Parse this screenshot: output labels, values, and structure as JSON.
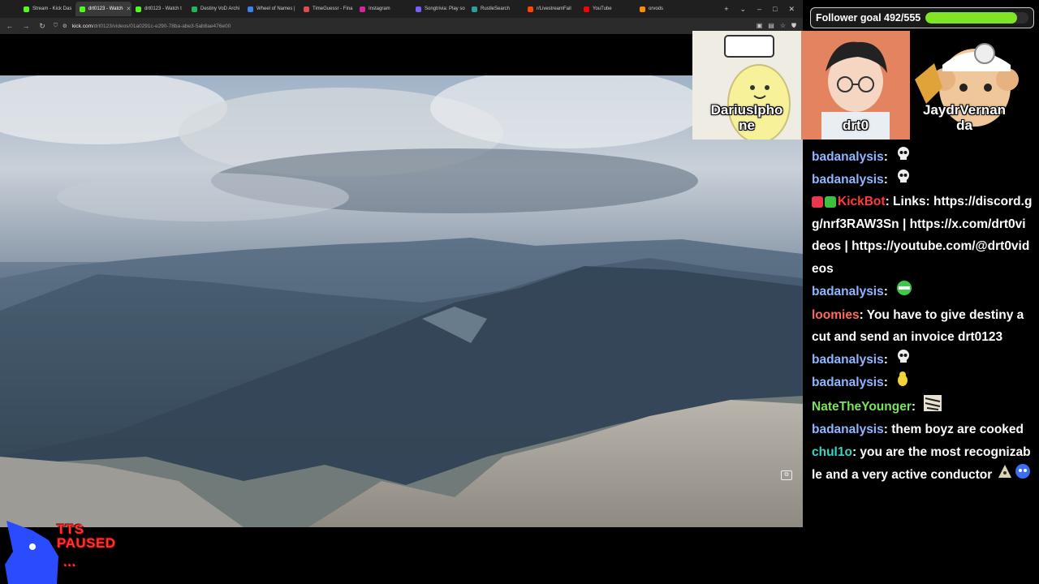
{
  "browser": {
    "tabs": [
      {
        "label": "Stream - Kick Das",
        "color": "#53fc18",
        "active": false
      },
      {
        "label": "drt0123 - Watch",
        "color": "#53fc18",
        "active": true
      },
      {
        "label": "drt0123 - Watch t",
        "color": "#53fc18",
        "active": false
      },
      {
        "label": "Destiny VoD Archi",
        "color": "#1db954",
        "active": false
      },
      {
        "label": "Wheel of Names |",
        "color": "#3b82f6",
        "active": false
      },
      {
        "label": "TimeGuessr - Fina",
        "color": "#e34b4b",
        "active": false
      },
      {
        "label": "Instagram",
        "color": "#d6249f",
        "active": false
      },
      {
        "label": "Songtrivia: Play so",
        "color": "#7b5cff",
        "active": false
      },
      {
        "label": "RustleSearch",
        "color": "#2aa198",
        "active": false
      },
      {
        "label": "r/LivestreamFail",
        "color": "#ff4500",
        "active": false
      },
      {
        "label": "YouTube",
        "color": "#ff0000",
        "active": false
      },
      {
        "label": "orvods",
        "color": "#ff8c00",
        "active": false
      }
    ],
    "url_domain": "kick.com",
    "url_path": "/drt0123/videos/01a0291c-e290-78ba-abe3-5ab8ae476e00"
  },
  "overlay": {
    "goal_label": "Follower goal 492/555",
    "goal_current": 492,
    "goal_target": 555,
    "goal_color": "#7fe524",
    "avatars": [
      {
        "name_line1": "DariusIpho",
        "name_line2": "ne"
      },
      {
        "name_line1": "drt0",
        "name_line2": ""
      },
      {
        "name_line1": "JaydrVernan",
        "name_line2": "da"
      }
    ],
    "tts_line1": "TTS",
    "tts_line2": "PAUSED",
    "tts_dots": "..."
  },
  "chat": {
    "messages": [
      {
        "user": "badanalysis",
        "color": "#8fb6ff",
        "text": "",
        "emote": "skull-emote"
      },
      {
        "user": "badanalysis",
        "color": "#8fb6ff",
        "text": "",
        "emote": "skull-emote"
      },
      {
        "user": "KickBot",
        "color": "#ff3b3b",
        "text": "Links: https://discord.gg/nrf3RAW3Sn | https://x.com/drt0videos | https://youtube.com/@drt0videos",
        "emote": "",
        "badges": true
      },
      {
        "user": "badanalysis",
        "color": "#8fb6ff",
        "text": "",
        "emote": "green-face-emote"
      },
      {
        "user": "loomies",
        "color": "#ff6a5c",
        "text": "You have to give destiny a cut and send an invoice drt0123",
        "emote": ""
      },
      {
        "user": "badanalysis",
        "color": "#8fb6ff",
        "text": "",
        "emote": "skull-emote"
      },
      {
        "user": "badanalysis",
        "color": "#8fb6ff",
        "text": "",
        "emote": "yellow-duck-emote"
      },
      {
        "user": "NateTheYounger",
        "color": "#7be35a",
        "text": "",
        "emote": "zebra-emote"
      },
      {
        "user": "badanalysis",
        "color": "#8fb6ff",
        "text": "them boyz are cooked",
        "emote": ""
      },
      {
        "user": "chul1o",
        "color": "#35d7c3",
        "text": "you are the most recognizable and a very active conductor",
        "emote": "two-emotes"
      }
    ]
  }
}
